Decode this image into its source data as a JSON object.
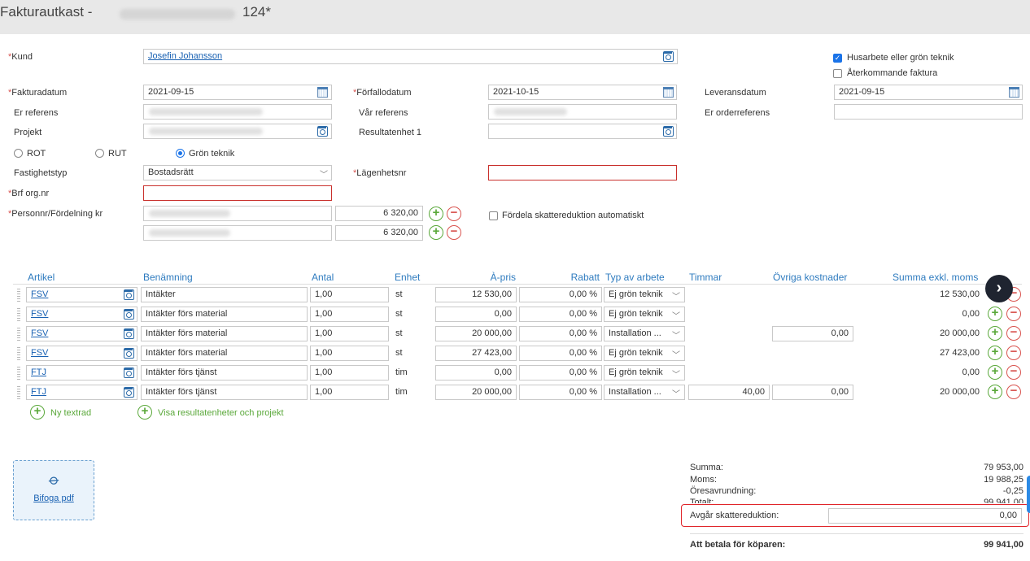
{
  "window": {
    "title_prefix": "Fakturautkast - ",
    "title_suffix": "124*"
  },
  "form": {
    "kund_label": "Kund",
    "kund_value": "Josefin Johansson",
    "husarbete_label": "Husarbete eller grön teknik",
    "husarbete_checked": true,
    "aterkommande_label": "Återkommande faktura",
    "aterkommande_checked": false,
    "fakturadatum_label": "Fakturadatum",
    "fakturadatum_value": "2021-09-15",
    "forfallodatum_label": "Förfallodatum",
    "forfallodatum_value": "2021-10-15",
    "leveransdatum_label": "Leveransdatum",
    "leveransdatum_value": "2021-09-15",
    "er_referens_label": "Er referens",
    "var_referens_label": "Vår referens",
    "er_orderreferens_label": "Er orderreferens",
    "projekt_label": "Projekt",
    "resultatenhet_label": "Resultatenhet 1",
    "radio_rot": "ROT",
    "radio_rut": "RUT",
    "radio_gron": "Grön teknik",
    "radio_selected": "Grön teknik",
    "fastighetstyp_label": "Fastighetstyp",
    "fastighetstyp_value": "Bostadsrätt",
    "lagenhetsnr_label": "Lägenhetsnr",
    "brf_label": "Brf org.nr",
    "personnr_label": "Personnr/Fördelning kr",
    "personnr_amount_1": "6 320,00",
    "personnr_amount_2": "6 320,00",
    "fordela_label": "Fördela skattereduktion automatiskt",
    "fordela_checked": false
  },
  "table": {
    "headers": {
      "artikel": "Artikel",
      "benamning": "Benämning",
      "antal": "Antal",
      "enhet": "Enhet",
      "apris": "À-pris",
      "rabatt": "Rabatt",
      "typ": "Typ av arbete",
      "timmar": "Timmar",
      "ovriga": "Övriga kostnader",
      "summa": "Summa exkl. moms"
    },
    "rows": [
      {
        "artikel": "FSV",
        "benamning": "Intäkter",
        "antal": "1,00",
        "enhet": "st",
        "apris": "12 530,00",
        "rabatt": "0,00 %",
        "typ": "Ej grön teknik",
        "timmar": "",
        "ovriga": "",
        "summa": "12 530,00"
      },
      {
        "artikel": "FSV",
        "benamning": "Intäkter förs material",
        "antal": "1,00",
        "enhet": "st",
        "apris": "0,00",
        "rabatt": "0,00 %",
        "typ": "Ej grön teknik",
        "timmar": "",
        "ovriga": "",
        "summa": "0,00"
      },
      {
        "artikel": "FSV",
        "benamning": "Intäkter förs material",
        "antal": "1,00",
        "enhet": "st",
        "apris": "20 000,00",
        "rabatt": "0,00 %",
        "typ": "Installation ...",
        "timmar": "",
        "ovriga": "0,00",
        "summa": "20 000,00"
      },
      {
        "artikel": "FSV",
        "benamning": "Intäkter förs material",
        "antal": "1,00",
        "enhet": "st",
        "apris": "27 423,00",
        "rabatt": "0,00 %",
        "typ": "Ej grön teknik",
        "timmar": "",
        "ovriga": "",
        "summa": "27 423,00"
      },
      {
        "artikel": "FTJ",
        "benamning": "Intäkter förs tjänst",
        "antal": "1,00",
        "enhet": "tim",
        "apris": "0,00",
        "rabatt": "0,00 %",
        "typ": "Ej grön teknik",
        "timmar": "",
        "ovriga": "",
        "summa": "0,00"
      },
      {
        "artikel": "FTJ",
        "benamning": "Intäkter förs tjänst",
        "antal": "1,00",
        "enhet": "tim",
        "apris": "20 000,00",
        "rabatt": "0,00 %",
        "typ": "Installation ...",
        "timmar": "40,00",
        "ovriga": "0,00",
        "summa": "20 000,00"
      }
    ],
    "ny_textrad": "Ny textrad",
    "visa_resultat": "Visa resultatenheter och projekt"
  },
  "attach": {
    "label": "Bifoga pdf"
  },
  "summary": {
    "summa_label": "Summa:",
    "summa_value": "79 953,00",
    "moms_label": "Moms:",
    "moms_value": "19 988,25",
    "ores_label": "Öresavrundning:",
    "ores_value": "-0,25",
    "totalt_label": "Totalt:",
    "totalt_value": "99 941,00",
    "avgar_label": "Avgår skattereduktion:",
    "avgar_value": "0,00",
    "att_betala_label": "Att betala för köparen:",
    "att_betala_value": "99 941,00"
  },
  "colors": {
    "accent": "#2e7bbf",
    "error": "#c9302c",
    "positive": "#5aa83a",
    "negative": "#d9534f"
  },
  "icons": {
    "lookup": "search-list-icon",
    "calendar": "calendar-icon",
    "add": "plus-circle-icon",
    "remove": "minus-circle-icon",
    "next": "chevron-right-icon",
    "attach": "paperclip-icon"
  }
}
